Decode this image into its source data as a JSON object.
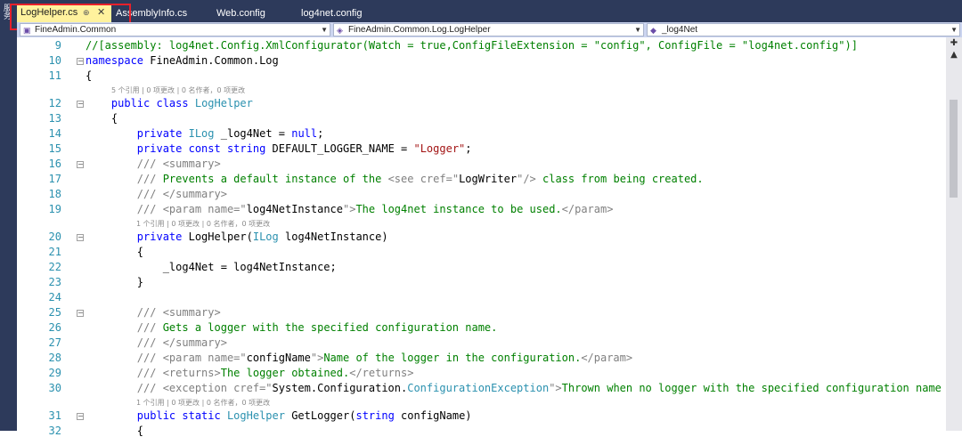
{
  "side_panel": {
    "label": "服务"
  },
  "tabs": [
    {
      "label": "LogHelper.cs",
      "active": true,
      "pin_icon": "pin-icon",
      "close_icon": "close-icon"
    },
    {
      "label": "AssemblyInfo.cs",
      "active": false
    },
    {
      "label": "Web.config",
      "active": false
    },
    {
      "label": "log4net.config",
      "active": false
    }
  ],
  "navbar": {
    "project": "FineAdmin.Common",
    "type": "FineAdmin.Common.Log.LogHelper",
    "member": "_log4Net"
  },
  "lines": [
    {
      "number": "9",
      "tokens": [
        [
          "c",
          "//[assembly: log4net.Config.XmlConfigurator(Watch = true,ConfigFileExtension = \"config\", ConfigFile = \"log4net.config\")]"
        ]
      ]
    },
    {
      "number": "10",
      "fold": "−",
      "tokens": [
        [
          "k",
          "namespace"
        ],
        [
          "n",
          " FineAdmin.Common.Log"
        ]
      ]
    },
    {
      "number": "11",
      "tokens": [
        [
          "n",
          "{"
        ]
      ]
    },
    {
      "lens": "5 个引用 | 0 项更改 | 0 名作者，0 项更改",
      "indent": 1
    },
    {
      "number": "12",
      "fold": "−",
      "tokens": [
        [
          "n",
          "    "
        ],
        [
          "k",
          "public class"
        ],
        [
          "n",
          " "
        ],
        [
          "t",
          "LogHelper"
        ]
      ]
    },
    {
      "number": "13",
      "tokens": [
        [
          "n",
          "    {"
        ]
      ]
    },
    {
      "number": "14",
      "tokens": [
        [
          "n",
          "        "
        ],
        [
          "k",
          "private"
        ],
        [
          "n",
          " "
        ],
        [
          "t",
          "ILog"
        ],
        [
          "n",
          " _log4Net = "
        ],
        [
          "k",
          "null"
        ],
        [
          "n",
          ";"
        ]
      ]
    },
    {
      "number": "15",
      "tokens": [
        [
          "n",
          "        "
        ],
        [
          "k",
          "private const string"
        ],
        [
          "n",
          " DEFAULT_LOGGER_NAME = "
        ],
        [
          "s",
          "\"Logger\""
        ],
        [
          "n",
          ";"
        ]
      ]
    },
    {
      "number": "16",
      "fold": "−",
      "tokens": [
        [
          "n",
          "        "
        ],
        [
          "g",
          "/// <summary>"
        ]
      ]
    },
    {
      "number": "17",
      "tokens": [
        [
          "n",
          "        "
        ],
        [
          "g",
          "/// "
        ],
        [
          "c",
          "Prevents a default instance of the "
        ],
        [
          "g",
          "<see cref=\""
        ],
        [
          "n",
          "LogWriter"
        ],
        [
          "g",
          "\"/>"
        ],
        [
          "c",
          " class from being created."
        ]
      ]
    },
    {
      "number": "18",
      "tokens": [
        [
          "n",
          "        "
        ],
        [
          "g",
          "/// </summary>"
        ]
      ]
    },
    {
      "number": "19",
      "tokens": [
        [
          "n",
          "        "
        ],
        [
          "g",
          "/// <param name=\""
        ],
        [
          "n",
          "log4NetInstance"
        ],
        [
          "g",
          "\">"
        ],
        [
          "c",
          "The log4net instance to be used."
        ],
        [
          "g",
          "</param>"
        ]
      ]
    },
    {
      "lens": "1 个引用 | 0 项更改 | 0 名作者，0 项更改",
      "indent": 2
    },
    {
      "number": "20",
      "fold": "−",
      "tokens": [
        [
          "n",
          "        "
        ],
        [
          "k",
          "private"
        ],
        [
          "n",
          " LogHelper("
        ],
        [
          "t",
          "ILog"
        ],
        [
          "n",
          " log4NetInstance)"
        ]
      ]
    },
    {
      "number": "21",
      "tokens": [
        [
          "n",
          "        {"
        ]
      ]
    },
    {
      "number": "22",
      "tokens": [
        [
          "n",
          "            _log4Net = log4NetInstance;"
        ]
      ]
    },
    {
      "number": "23",
      "tokens": [
        [
          "n",
          "        }"
        ]
      ]
    },
    {
      "number": "24",
      "tokens": []
    },
    {
      "number": "25",
      "fold": "−",
      "tokens": [
        [
          "n",
          "        "
        ],
        [
          "g",
          "/// <summary>"
        ]
      ]
    },
    {
      "number": "26",
      "tokens": [
        [
          "n",
          "        "
        ],
        [
          "g",
          "/// "
        ],
        [
          "c",
          "Gets a logger with the specified configuration name."
        ]
      ]
    },
    {
      "number": "27",
      "tokens": [
        [
          "n",
          "        "
        ],
        [
          "g",
          "/// </summary>"
        ]
      ]
    },
    {
      "number": "28",
      "tokens": [
        [
          "n",
          "        "
        ],
        [
          "g",
          "/// <param name=\""
        ],
        [
          "n",
          "configName"
        ],
        [
          "g",
          "\">"
        ],
        [
          "c",
          "Name of the logger in the configuration."
        ],
        [
          "g",
          "</param>"
        ]
      ]
    },
    {
      "number": "29",
      "tokens": [
        [
          "n",
          "        "
        ],
        [
          "g",
          "/// <returns>"
        ],
        [
          "c",
          "The logger obtained."
        ],
        [
          "g",
          "</returns>"
        ]
      ]
    },
    {
      "number": "30",
      "tokens": [
        [
          "n",
          "        "
        ],
        [
          "g",
          "/// <exception cref=\""
        ],
        [
          "n",
          "System.Configuration."
        ],
        [
          "t",
          "ConfigurationException"
        ],
        [
          "g",
          "\">"
        ],
        [
          "c",
          "Thrown when no logger with the specified configuration name was"
        ]
      ]
    },
    {
      "lens": "1 个引用 | 0 项更改 | 0 名作者，0 项更改",
      "indent": 2
    },
    {
      "number": "31",
      "fold": "−",
      "tokens": [
        [
          "n",
          "        "
        ],
        [
          "k",
          "public static"
        ],
        [
          "n",
          " "
        ],
        [
          "t",
          "LogHelper"
        ],
        [
          "n",
          " GetLogger("
        ],
        [
          "k",
          "string"
        ],
        [
          "n",
          " configName)"
        ]
      ]
    },
    {
      "number": "32",
      "tokens": [
        [
          "n",
          "        {"
        ]
      ]
    }
  ],
  "colors": {
    "keyword": "#0000ff",
    "type": "#2b91af",
    "string": "#a31515",
    "comment": "#008000",
    "doc_tag": "#808080",
    "tab_active": "#fff29d",
    "tabbar": "#2d3a5b",
    "highlight_box": "#e8202a"
  }
}
